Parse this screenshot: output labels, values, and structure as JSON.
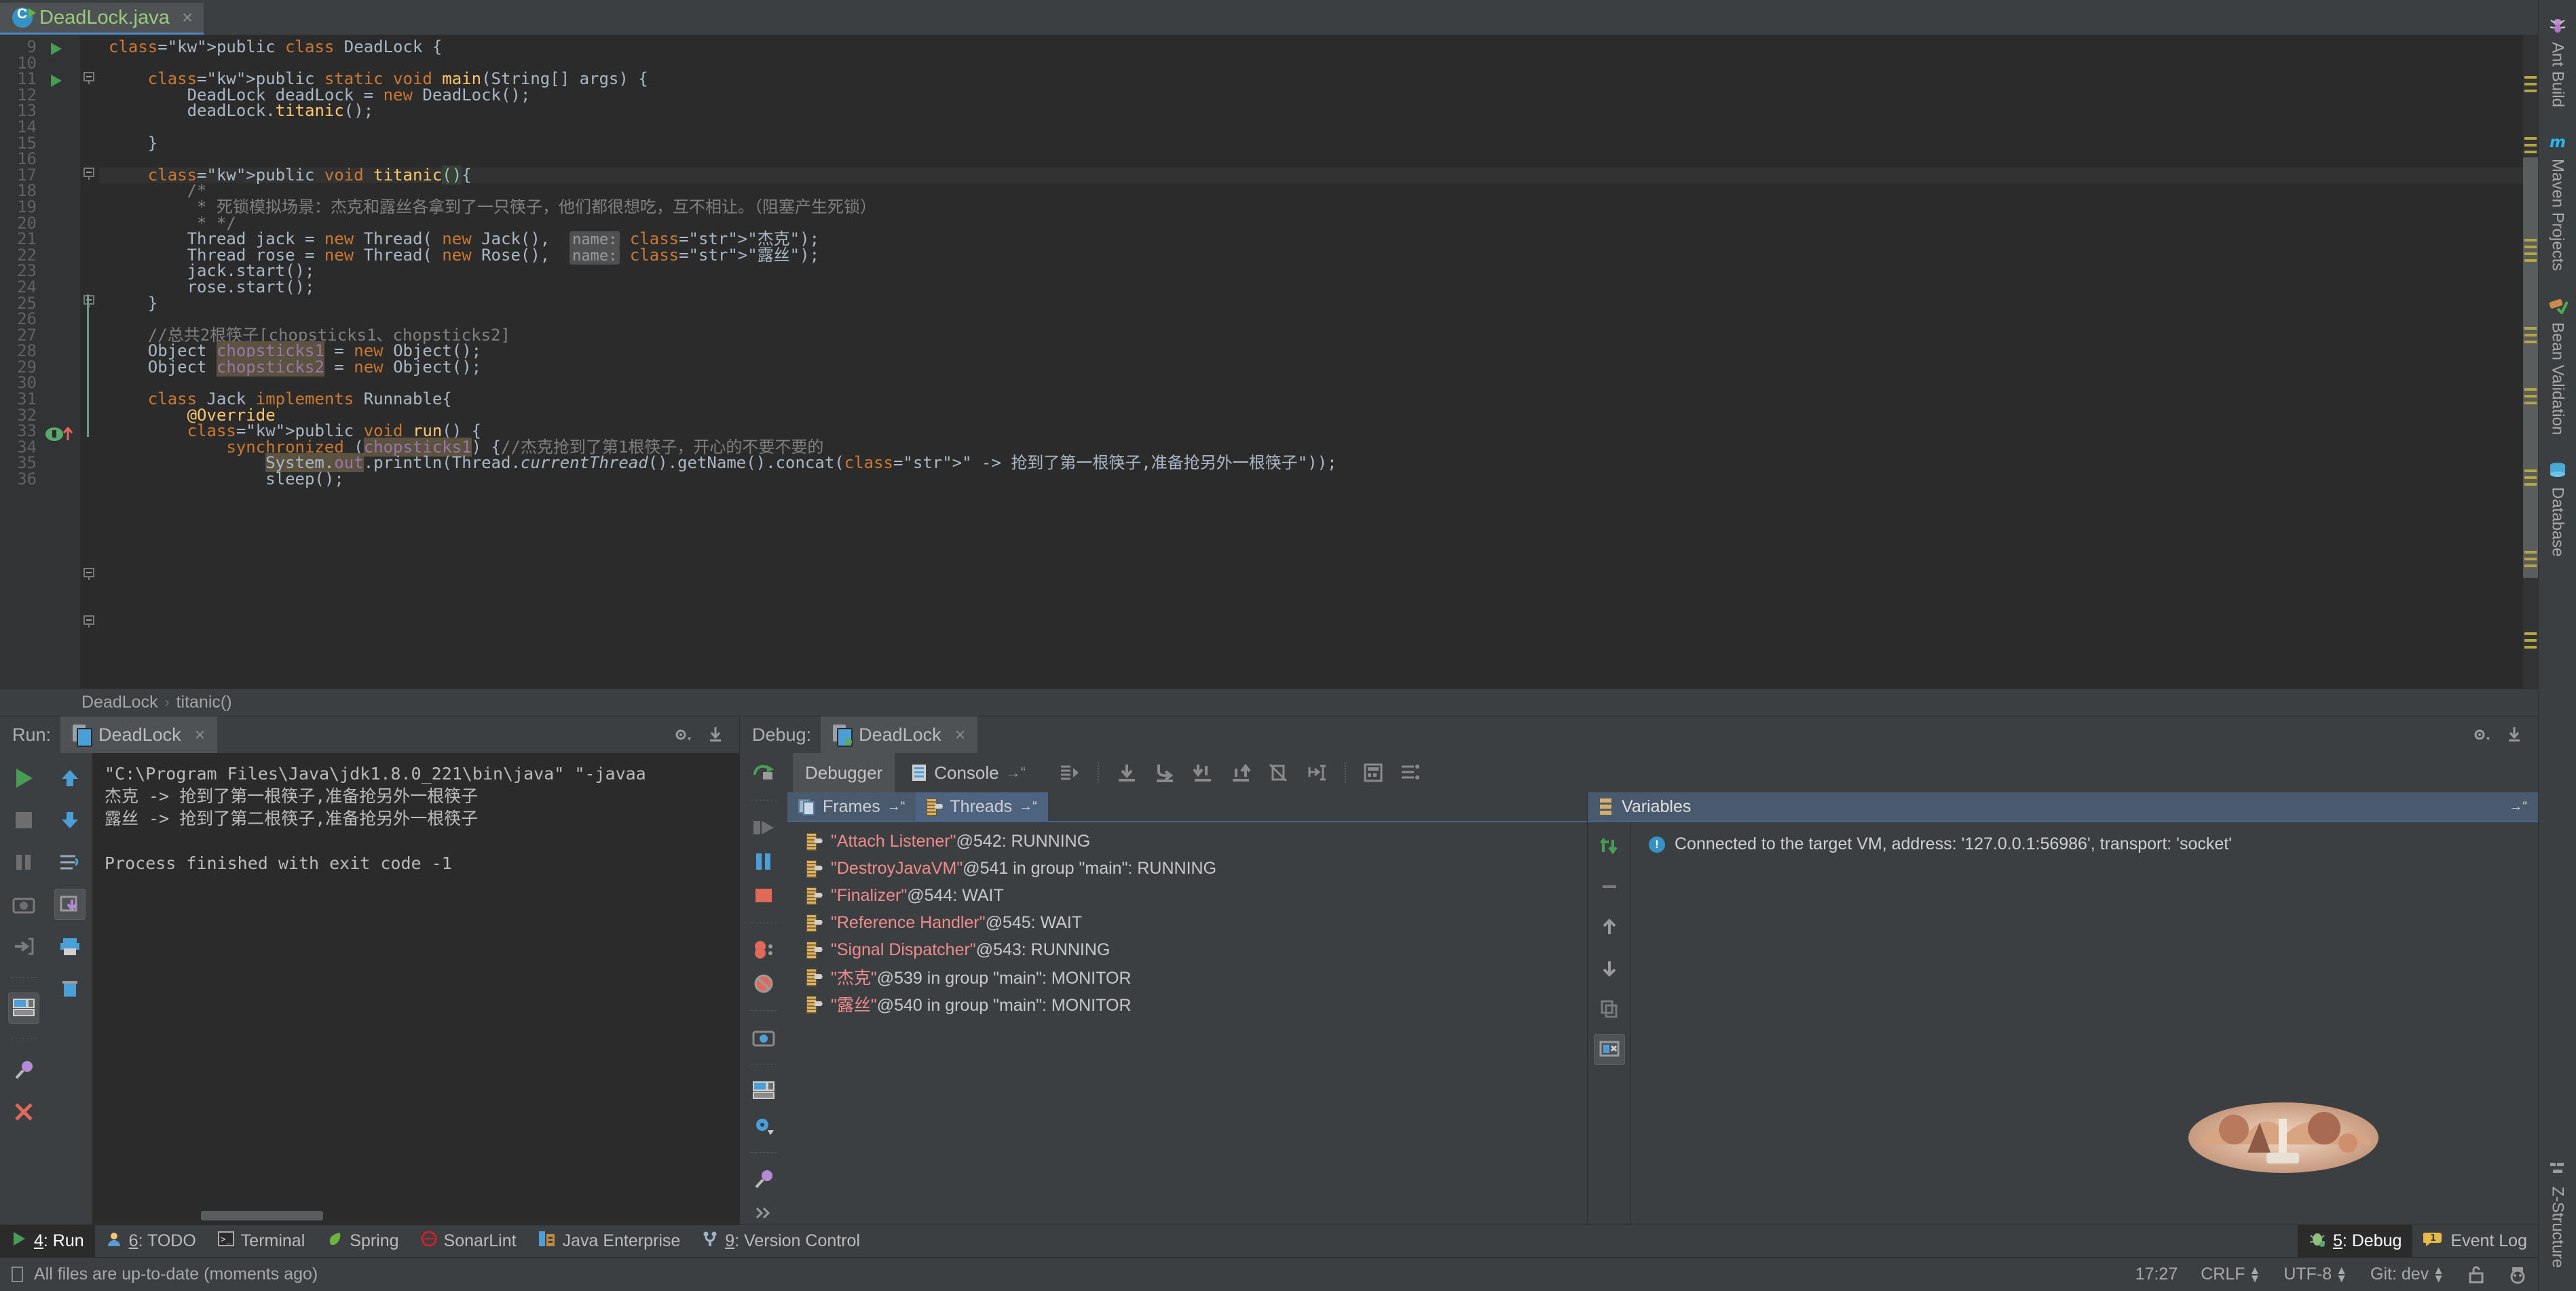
{
  "editor": {
    "tab": {
      "filename": "DeadLock.java",
      "close": "×",
      "icon": "java-class-icon"
    },
    "first_line_no": 9,
    "lines": [
      {
        "n": 9,
        "text": "public class DeadLock {"
      },
      {
        "n": 10,
        "text": ""
      },
      {
        "n": 11,
        "text": "    public static void main(String[] args) {"
      },
      {
        "n": 12,
        "text": "        DeadLock deadLock = new DeadLock();"
      },
      {
        "n": 13,
        "text": "        deadLock.titanic();"
      },
      {
        "n": 14,
        "text": ""
      },
      {
        "n": 15,
        "text": "    }"
      },
      {
        "n": 16,
        "text": ""
      },
      {
        "n": 17,
        "text": "    public void titanic(){"
      },
      {
        "n": 18,
        "text": "        /*"
      },
      {
        "n": 19,
        "text": "         * 死锁模拟场景：杰克和露丝各拿到了一只筷子，他们都很想吃，互不相让。（阻塞产生死锁）"
      },
      {
        "n": 20,
        "text": "         * */"
      },
      {
        "n": 21,
        "text": "        Thread jack = new Thread( new Jack(),  name: \"杰克\");"
      },
      {
        "n": 22,
        "text": "        Thread rose = new Thread( new Rose(),  name: \"露丝\");"
      },
      {
        "n": 23,
        "text": "        jack.start();"
      },
      {
        "n": 24,
        "text": "        rose.start();"
      },
      {
        "n": 25,
        "text": "    }"
      },
      {
        "n": 26,
        "text": ""
      },
      {
        "n": 27,
        "text": "    //总共2根筷子[chopsticks1、chopsticks2]"
      },
      {
        "n": 28,
        "text": "    Object chopsticks1 = new Object();"
      },
      {
        "n": 29,
        "text": "    Object chopsticks2 = new Object();"
      },
      {
        "n": 30,
        "text": ""
      },
      {
        "n": 31,
        "text": "    class Jack implements Runnable{"
      },
      {
        "n": 32,
        "text": "        @Override"
      },
      {
        "n": 33,
        "text": "        public void run() {"
      },
      {
        "n": 34,
        "text": "            synchronized (chopsticks1) {//杰克抢到了第1根筷子，开心的不要不要的"
      },
      {
        "n": 35,
        "text": "                System.out.println(Thread.currentThread().getName().concat(\" -> 抢到了第一根筷子,准备抢另外一根筷子\"));"
      },
      {
        "n": 36,
        "text": "                sleep();"
      }
    ],
    "breadcrumb": [
      "DeadLock",
      "titanic()"
    ],
    "breadcrumb_sep": "›"
  },
  "right_tool_strip": [
    {
      "label": "Ant Build",
      "icon": "ant-icon"
    },
    {
      "label": "Maven Projects",
      "icon": "maven-m-icon"
    },
    {
      "label": "Bean Validation",
      "icon": "bean-validation-icon"
    },
    {
      "label": "Database",
      "icon": "database-icon"
    },
    {
      "label": "Z-Structure",
      "icon": "structure-icon"
    }
  ],
  "run_panel": {
    "caption": "Run:",
    "tab_label": "DeadLock",
    "tab_close": "×",
    "header_icons": [
      "settings-gear-icon",
      "hide-icon"
    ],
    "toolbar_left": [
      "rerun-icon",
      "stop-icon",
      "pause-icon",
      "camera-icon",
      "export-icon",
      "layout-icon",
      "pin-icon",
      "close-icon"
    ],
    "toolbar_right": [
      "scroll-up-icon",
      "scroll-down-icon",
      "soft-wrap-icon",
      "scroll-to-end-icon",
      "print-icon",
      "trash-icon"
    ],
    "console_lines": [
      "\"C:\\Program Files\\Java\\jdk1.8.0_221\\bin\\java\" \"-javaa",
      "杰克 -> 抢到了第一根筷子,准备抢另外一根筷子",
      "露丝 -> 抢到了第二根筷子,准备抢另外一根筷子",
      "",
      "Process finished with exit code -1"
    ]
  },
  "debug_panel": {
    "caption": "Debug:",
    "tab_label": "DeadLock",
    "tab_close": "×",
    "header_icons": [
      "settings-gear-icon",
      "hide-icon"
    ],
    "tabs": [
      {
        "label": "Debugger",
        "icon": "debugger-icon",
        "active": true
      },
      {
        "label": "Console",
        "icon": "console-icon",
        "active": false
      }
    ],
    "step_icons": [
      "show-execution-point-icon",
      "step-over-icon",
      "step-into-icon",
      "force-step-into-icon",
      "step-out-icon",
      "drop-frame-icon",
      "run-to-cursor-icon",
      "evaluate-expression-icon",
      "watches-icon"
    ],
    "toolbar_left": [
      "rerun-icon",
      "resume-icon",
      "pause-icon",
      "stop-icon",
      "view-breakpoints-icon",
      "mute-breakpoints-icon",
      "camera-icon",
      "layout-icon",
      "settings-gear-icon",
      "pin-icon",
      "more-icon"
    ],
    "frames_tab": "Frames",
    "threads_tab": "Threads",
    "threads": [
      {
        "name": "\"Attach Listener\"",
        "rest": "@542: RUNNING"
      },
      {
        "name": "\"DestroyJavaVM\"",
        "rest": "@541 in group \"main\": RUNNING"
      },
      {
        "name": "\"Finalizer\"",
        "rest": "@544: WAIT"
      },
      {
        "name": "\"Reference Handler\"",
        "rest": "@545: WAIT"
      },
      {
        "name": "\"Signal Dispatcher\"",
        "rest": "@543: RUNNING"
      },
      {
        "name": "\"杰克\"",
        "rest": "@539 in group \"main\": MONITOR"
      },
      {
        "name": "\"露丝\"",
        "rest": "@540 in group \"main\": MONITOR"
      }
    ],
    "variables": {
      "title": "Variables",
      "message": "Connected to the target VM, address: '127.0.0.1:56986', transport: 'socket'",
      "tools": [
        "evaluate-expression-icon",
        "minus-icon",
        "up-icon",
        "down-icon",
        "copy-icon",
        "inspect-icon"
      ]
    }
  },
  "tool_window_bar": {
    "left": [
      {
        "label": "4: Run",
        "num": "4",
        "icon": "run-icon",
        "active": true
      },
      {
        "label": "6: TODO",
        "num": "6",
        "icon": "todo-icon",
        "active": false
      },
      {
        "label": "Terminal",
        "num": "",
        "icon": "terminal-icon",
        "active": false
      },
      {
        "label": "Spring",
        "num": "",
        "icon": "spring-leaf-icon",
        "active": false
      },
      {
        "label": "SonarLint",
        "num": "",
        "icon": "sonarlint-icon",
        "active": false
      },
      {
        "label": "Java Enterprise",
        "num": "",
        "icon": "java-enterprise-icon",
        "active": false
      },
      {
        "label": "9: Version Control",
        "num": "9",
        "icon": "version-control-icon",
        "active": false
      }
    ],
    "right": [
      {
        "label": "5: Debug",
        "num": "5",
        "icon": "debug-bug-icon",
        "active": true
      },
      {
        "label": "Event Log",
        "num": "",
        "icon": "event-log-icon",
        "badge": "1",
        "active": false
      }
    ]
  },
  "status_bar": {
    "message": "All files are up-to-date (moments ago)",
    "message_icon": "file-icon",
    "time": "17:27",
    "line_sep": "CRLF",
    "encoding": "UTF-8",
    "branch": "Git: dev",
    "lock_icon": "lock-icon",
    "inspector_icon": "inspector-icon"
  },
  "colors": {
    "background": "#3c3f41",
    "editor_bg": "#2b2b2b",
    "accent_blue": "#4a88c7",
    "keyword": "#cc7832",
    "string": "#6a8759",
    "comment": "#808080",
    "field": "#9876aa",
    "method": "#ffc66d",
    "thread_name": "#ef8b8b",
    "tab_green": "#9aca7a"
  }
}
